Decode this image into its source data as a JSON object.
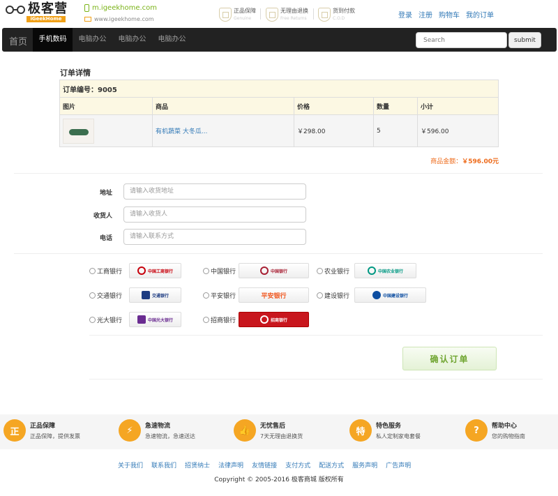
{
  "header": {
    "logo_cn": "极客营",
    "logo_en": "iGeekHome",
    "mobile_site": "m.igeekhome.com",
    "www_site": "www.igeekhome.com",
    "promises": [
      {
        "cn": "正品保障",
        "en": "Genuine",
        "icon": "shield-icon"
      },
      {
        "cn": "无理由退换",
        "en": "Free Returns",
        "icon": "return-icon"
      },
      {
        "cn": "货到付款",
        "en": "C.O.D",
        "icon": "cod-icon"
      }
    ],
    "links": {
      "login": "登录",
      "register": "注册",
      "cart": "购物车",
      "orders": "我的订单"
    }
  },
  "nav": {
    "brand": "首页",
    "items": [
      "手机数码",
      "电脑办公",
      "电脑办公",
      "电脑办公"
    ],
    "active_index": 0,
    "search_placeholder": "Search",
    "submit_label": "submit"
  },
  "order": {
    "title": "订单详情",
    "order_no": "订单编号：9005",
    "columns": {
      "image": "图片",
      "product": "商品",
      "price": "价格",
      "qty": "数量",
      "subtotal": "小计"
    },
    "items": [
      {
        "name": "有机蔬菜 大冬瓜...",
        "price": "￥298.00",
        "qty": "5",
        "subtotal": "￥596.00"
      }
    ],
    "total_label": "商品金额：",
    "total_value": "￥596.00元"
  },
  "form": {
    "address_label": "地址",
    "address_placeholder": "请输入收货地址",
    "receiver_label": "收货人",
    "receiver_placeholder": "请输入收货人",
    "phone_label": "电话",
    "phone_placeholder": "请输入联系方式"
  },
  "banks": [
    {
      "name": "工商银行",
      "logo": "中国工商银行",
      "color": "#c7000b"
    },
    {
      "name": "中国银行",
      "logo": "中国银行",
      "color": "#a71e32"
    },
    {
      "name": "农业银行",
      "logo": "中国农业银行",
      "color": "#009882"
    },
    {
      "name": "交通银行",
      "logo": "交通银行",
      "color": "#1d3c82"
    },
    {
      "name": "平安银行",
      "logo": "平安银行",
      "color": "#f05a23"
    },
    {
      "name": "建设银行",
      "logo": "中国建设银行",
      "color": "#0d4ea1"
    },
    {
      "name": "光大银行",
      "logo": "中国光大银行",
      "color": "#6a2c91"
    },
    {
      "name": "招商银行",
      "logo": "招商银行",
      "color": "#c8161d"
    }
  ],
  "confirm_label": "确认订单",
  "features": [
    {
      "title": "正品保障",
      "desc": "正品保障，提供发票",
      "icon": "genuine-icon",
      "glyph": "正"
    },
    {
      "title": "急速物流",
      "desc": "急速物流，急速送达",
      "icon": "express-icon",
      "glyph": "⚡"
    },
    {
      "title": "无忧售后",
      "desc": "7天无理由退换货",
      "icon": "thumbs-up-icon",
      "glyph": "👍"
    },
    {
      "title": "特色服务",
      "desc": "私人定制家电套餐",
      "icon": "special-icon",
      "glyph": "特"
    },
    {
      "title": "帮助中心",
      "desc": "您的购物指南",
      "icon": "help-icon",
      "glyph": "?"
    }
  ],
  "footer_links": [
    "关于我们",
    "联系我们",
    "招贤纳士",
    "法律声明",
    "友情链接",
    "支付方式",
    "配送方式",
    "服务声明",
    "广告声明"
  ],
  "copyright": "Copyright © 2005-2016 极客商城 版权所有",
  "colors": {
    "accent_orange": "#f5a623",
    "total_orange": "#ee6b1b",
    "nav_bg": "#222222",
    "green": "#7ab317"
  }
}
